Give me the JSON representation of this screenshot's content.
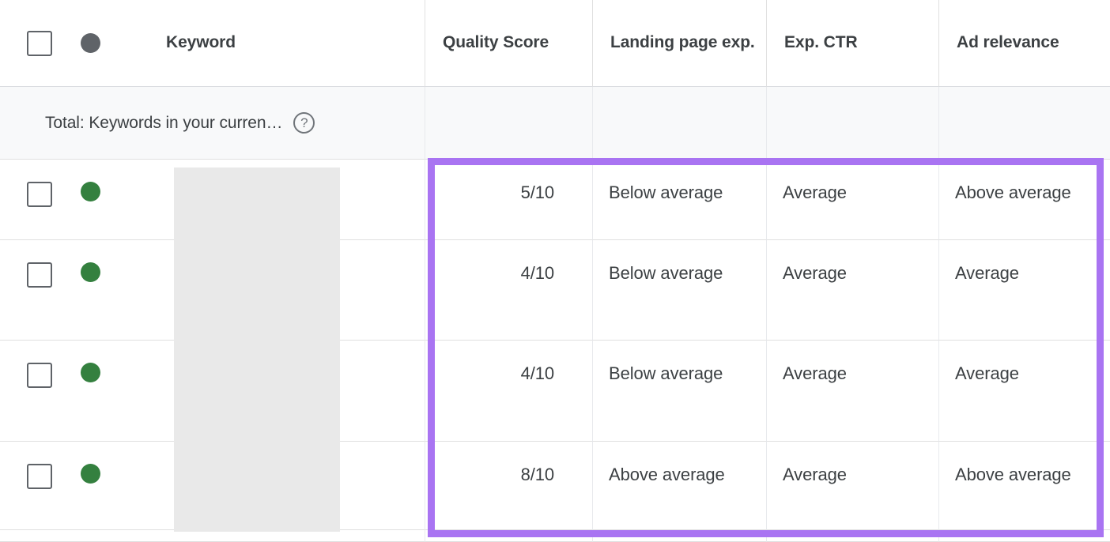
{
  "table": {
    "columns": [
      {
        "key": "keyword",
        "label": "Keyword"
      },
      {
        "key": "quality_score",
        "label": "Quality Score"
      },
      {
        "key": "landing_page",
        "label": "Landing page exp."
      },
      {
        "key": "exp_ctr",
        "label": "Exp. CTR"
      },
      {
        "key": "ad_relevance",
        "label": "Ad relevance"
      }
    ],
    "header": {
      "keyword_label": "Keyword",
      "quality_score_label": "Quality Score",
      "landing_page_label": "Landing page exp.",
      "exp_ctr_label": "Exp. CTR",
      "ad_relevance_label": "Ad relevance",
      "status_dot_color": "#5f6368"
    },
    "total_row": {
      "text": "Total: Keywords in your curren…",
      "help_icon": "help-circle-icon"
    },
    "rows": [
      {
        "status_dot_color": "#34803f",
        "keyword": "",
        "quality_score": "5/10",
        "landing_page": "Below average",
        "exp_ctr": "Average",
        "ad_relevance": "Above average"
      },
      {
        "status_dot_color": "#34803f",
        "keyword": "",
        "quality_score": "4/10",
        "landing_page": "Below average",
        "exp_ctr": "Average",
        "ad_relevance": "Average"
      },
      {
        "status_dot_color": "#34803f",
        "keyword": "",
        "quality_score": "4/10",
        "landing_page": "Below average",
        "exp_ctr": "Average",
        "ad_relevance": "Average"
      },
      {
        "status_dot_color": "#34803f",
        "keyword": "",
        "quality_score": "8/10",
        "landing_page": "Above average",
        "exp_ctr": "Average",
        "ad_relevance": "Above average"
      }
    ]
  },
  "annotation": {
    "highlight_color": "#a974f2",
    "highlight_label": ""
  },
  "colors": {
    "highlight_purple": "#a974f2",
    "status_green": "#34803f",
    "status_gray": "#5f6368",
    "text_primary": "#3c4043",
    "total_row_bg": "#f8f9fa",
    "redaction_gray": "#e9e9e9"
  }
}
